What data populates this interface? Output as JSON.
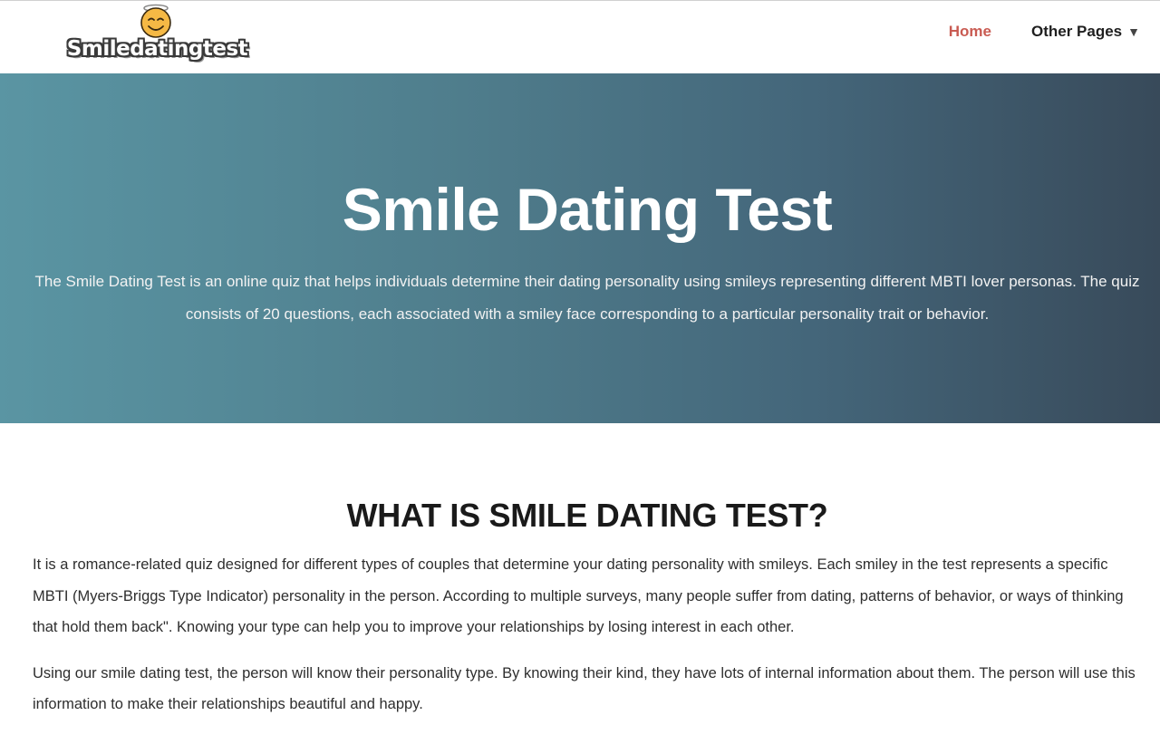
{
  "header": {
    "logo_text": "Smiledatingtest",
    "logo_icon": "halo-smiley-icon",
    "nav": {
      "home_label": "Home",
      "other_label": "Other Pages",
      "other_caret": "▼"
    }
  },
  "hero": {
    "title": "Smile Dating Test",
    "description": "The Smile Dating Test is an online quiz that helps individuals determine their dating personality using smileys representing different MBTI lover personas. The quiz consists of 20 questions, each associated with a smiley face corresponding to a particular personality trait or behavior."
  },
  "section": {
    "heading": "WHAT IS SMILE DATING TEST?",
    "paragraphs": [
      "It is a romance-related quiz designed for different types of couples that determine your dating personality with smileys. Each smiley in the test represents a specific MBTI (Myers-Briggs Type Indicator) personality in the person. According to multiple surveys, many people suffer from dating, patterns of behavior, or ways of thinking that hold them back\". Knowing your type can help you to improve your relationships by losing interest in each other.",
      "Using our smile dating test, the person will know their personality type. By knowing their kind, they have lots of internal information about them. The person will use this information to make their relationships beautiful and happy."
    ]
  },
  "colors": {
    "nav_active": "#c95b52",
    "hero_gradient_start": "#5a95a3",
    "hero_gradient_end": "#384a5a",
    "smiley_fill": "#f5b945"
  }
}
